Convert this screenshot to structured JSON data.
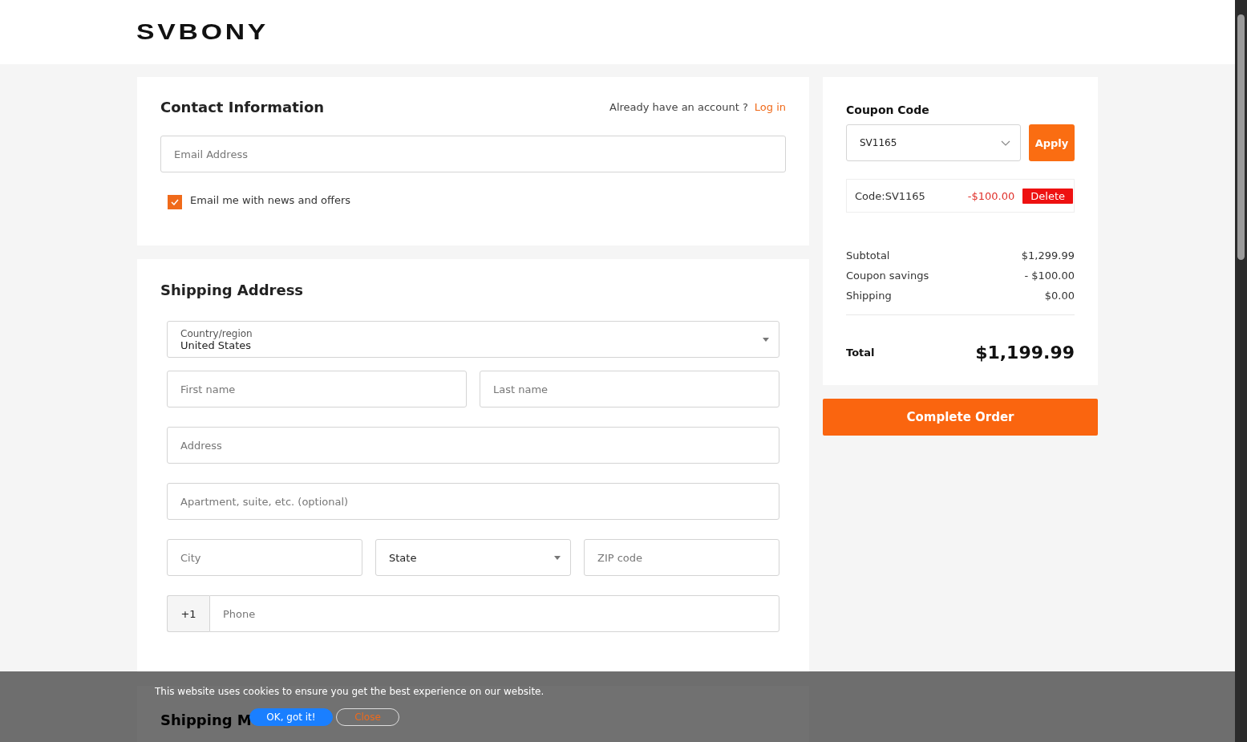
{
  "logo": "SVBONY",
  "contact": {
    "title": "Contact Information",
    "account_prompt": "Already have an account ?",
    "login_link": "Log in",
    "email": {
      "placeholder": "Email Address"
    },
    "newsletter": {
      "label": "Email me with news and offers",
      "checked": true
    }
  },
  "shipping": {
    "title": "Shipping Address",
    "country": {
      "label": "Country/region",
      "value": "United States"
    },
    "first_name": {
      "placeholder": "First name"
    },
    "last_name": {
      "placeholder": "Last name"
    },
    "address": {
      "placeholder": "Address"
    },
    "apartment": {
      "placeholder": "Apartment, suite, etc. (optional)"
    },
    "city": {
      "placeholder": "City"
    },
    "state": {
      "value": "State"
    },
    "zip": {
      "placeholder": "ZIP code"
    },
    "phone": {
      "prefix": "+1",
      "placeholder": "Phone"
    }
  },
  "shipping_method": {
    "title": "Shipping M"
  },
  "summary": {
    "coupon_title": "Coupon Code",
    "coupon_select": {
      "value": "SV1165"
    },
    "apply_button": "Apply",
    "applied_coupon": {
      "code": "Code:SV1165",
      "amount": "-$100.00",
      "delete_button": "Delete"
    },
    "lines": [
      {
        "label": "Subtotal",
        "value": "$1,299.99"
      },
      {
        "label": "Coupon savings",
        "value": "- $100.00"
      },
      {
        "label": "Shipping",
        "value": "$0.00"
      }
    ],
    "total": {
      "label": "Total",
      "value": "$1,199.99"
    }
  },
  "complete_button": "Complete Order",
  "cookie_banner": {
    "message": "This website uses cookies to ensure you get the best experience on our website.",
    "accept_button": "OK, got it!",
    "close_button": "Close"
  }
}
